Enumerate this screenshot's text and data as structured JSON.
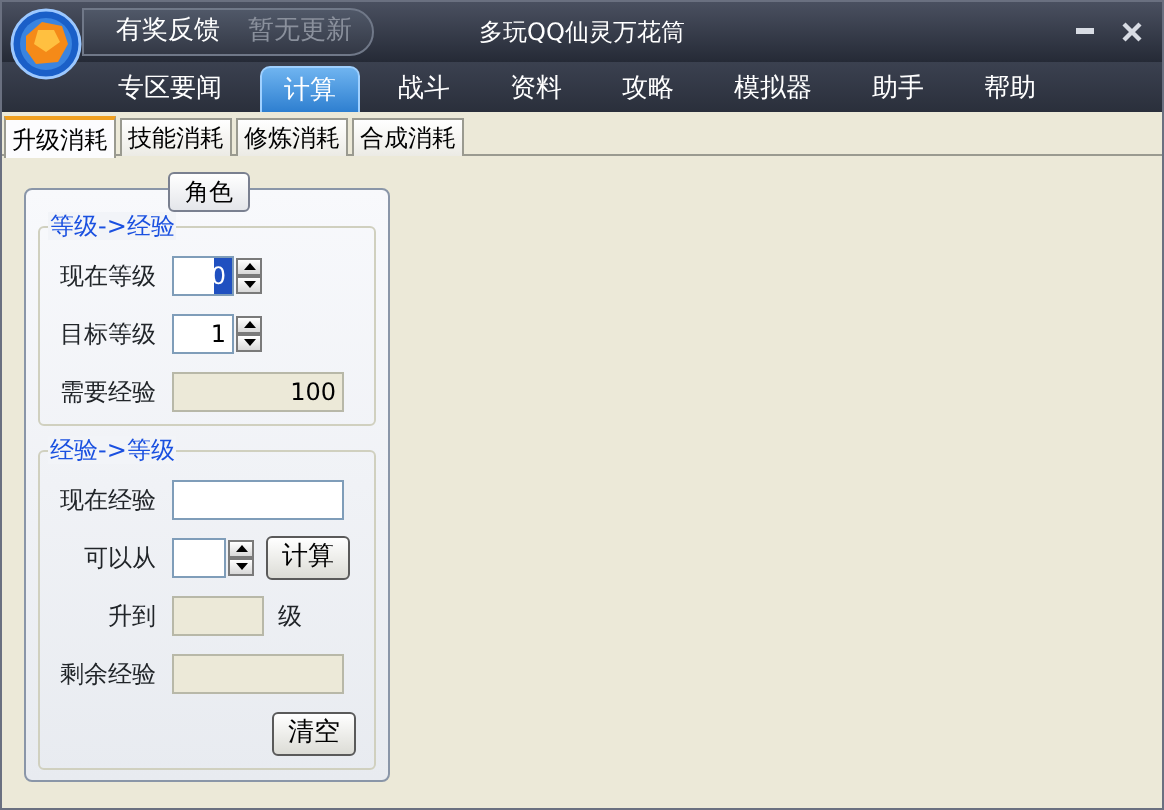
{
  "window": {
    "title": "多玩QQ仙灵万花筒",
    "header_links": [
      {
        "label": "有奖反馈",
        "disabled": false
      },
      {
        "label": "暂无更新",
        "disabled": true
      }
    ]
  },
  "nav": [
    {
      "label": "专区要闻",
      "selected": false
    },
    {
      "label": "计算",
      "selected": true
    },
    {
      "label": "战斗",
      "selected": false
    },
    {
      "label": "资料",
      "selected": false
    },
    {
      "label": "攻略",
      "selected": false
    },
    {
      "label": "模拟器",
      "selected": false
    },
    {
      "label": "助手",
      "selected": false
    },
    {
      "label": "帮助",
      "selected": false
    }
  ],
  "tabs": [
    {
      "label": "升级消耗",
      "selected": true
    },
    {
      "label": "技能消耗",
      "selected": false
    },
    {
      "label": "修炼消耗",
      "selected": false
    },
    {
      "label": "合成消耗",
      "selected": false
    }
  ],
  "panel": {
    "title": "角色",
    "groups": [
      {
        "title": "等级->经验",
        "rows": [
          {
            "kind": "spinner",
            "label": "现在等级",
            "value": "0",
            "focused": true
          },
          {
            "kind": "spinner",
            "label": "目标等级",
            "value": "1",
            "focused": false
          },
          {
            "kind": "readonly",
            "label": "需要经验",
            "value": "100"
          }
        ]
      },
      {
        "title": "经验->等级",
        "rows": [
          {
            "kind": "input",
            "label": "现在经验"
          },
          {
            "kind": "spinner_button",
            "label": "可以从",
            "button": "计算"
          },
          {
            "kind": "readonly_unit",
            "label": "升到",
            "unit": "级"
          },
          {
            "kind": "readonly",
            "label": "剩余经验"
          },
          {
            "kind": "button",
            "button": "清空"
          }
        ]
      }
    ]
  }
}
